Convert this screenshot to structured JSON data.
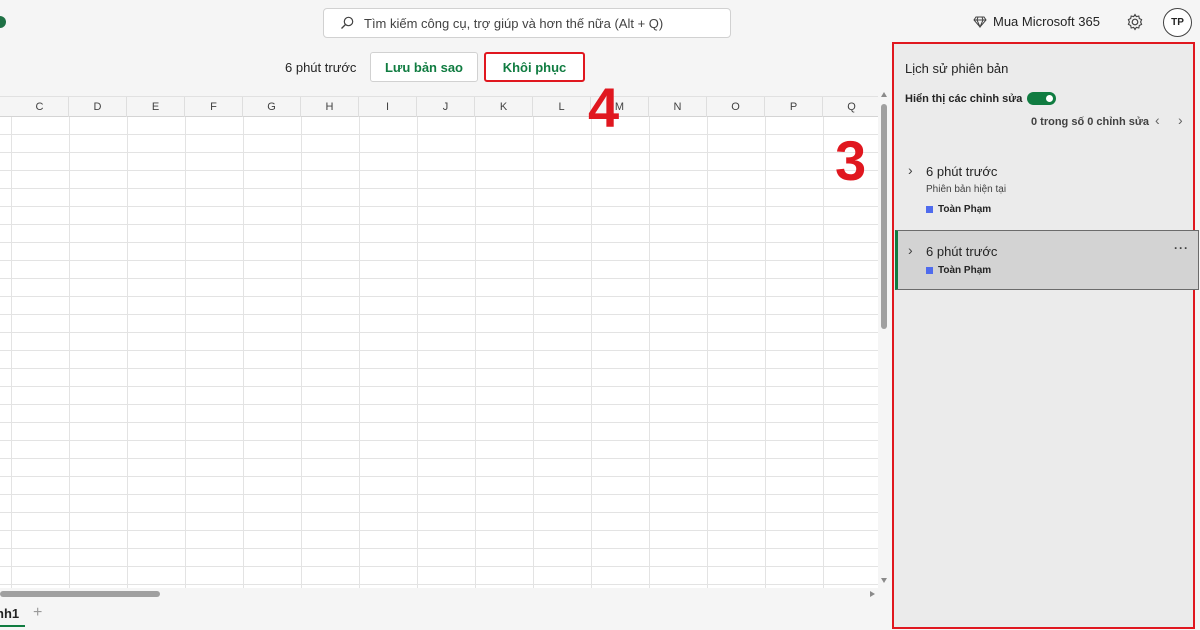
{
  "header": {
    "search_placeholder": "Tìm kiếm công cụ, trợ giúp và hơn thế nữa (Alt + Q)",
    "buy_label": "Mua Microsoft 365",
    "avatar_initials": "TP"
  },
  "restore_bar": {
    "version_time": "6 phút trước",
    "save_copy_label": "Lưu bản sao",
    "restore_label": "Khôi phục"
  },
  "annotations": {
    "step_4": "4",
    "step_3": "3"
  },
  "grid": {
    "columns": [
      "C",
      "D",
      "E",
      "F",
      "G",
      "H",
      "I",
      "J",
      "K",
      "L",
      "M",
      "N",
      "O",
      "P",
      "Q"
    ]
  },
  "sheets": {
    "active_tab": "nh1",
    "add_label": "+"
  },
  "panel": {
    "title": "Lịch sử phiên bản",
    "show_changes_label": "Hiển thị các chỉnh sửa",
    "show_changes_on": true,
    "changes_count": "0 trong số 0 chỉnh sửa",
    "versions": [
      {
        "time": "6 phút trước",
        "subtitle": "Phiên bản hiện tại",
        "author": "Toàn Phạm"
      },
      {
        "time": "6 phút trước",
        "author": "Toàn Phạm"
      }
    ]
  },
  "colors": {
    "accent_green": "#107c41",
    "highlight_red": "#e0171f",
    "author_blue": "#4f6bed"
  }
}
